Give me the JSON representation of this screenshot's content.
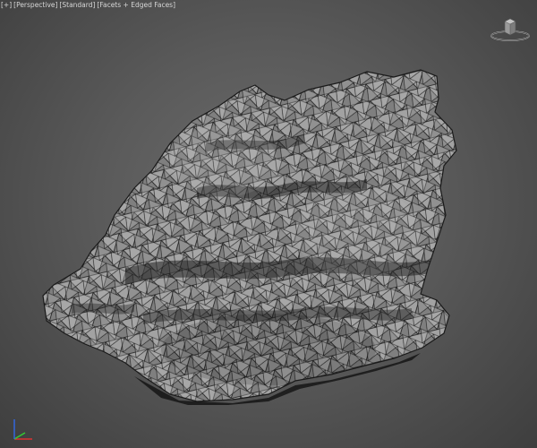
{
  "viewport": {
    "label_plus": "[+]",
    "label_view": "[Perspective]",
    "label_shading": "[Standard]",
    "label_display": "[Facets + Edged Faces]"
  },
  "colors": {
    "background_center": "#6c6c6c",
    "background_edge": "#3e3e3e",
    "mesh_face": "#8e8e8e",
    "mesh_edge": "#1a1a1a",
    "axis_x": "#d33",
    "axis_y": "#3c3",
    "axis_z": "#36d"
  },
  "icons": {
    "viewcube": "viewcube-icon",
    "axis_tripod": "axis-tripod-icon"
  }
}
